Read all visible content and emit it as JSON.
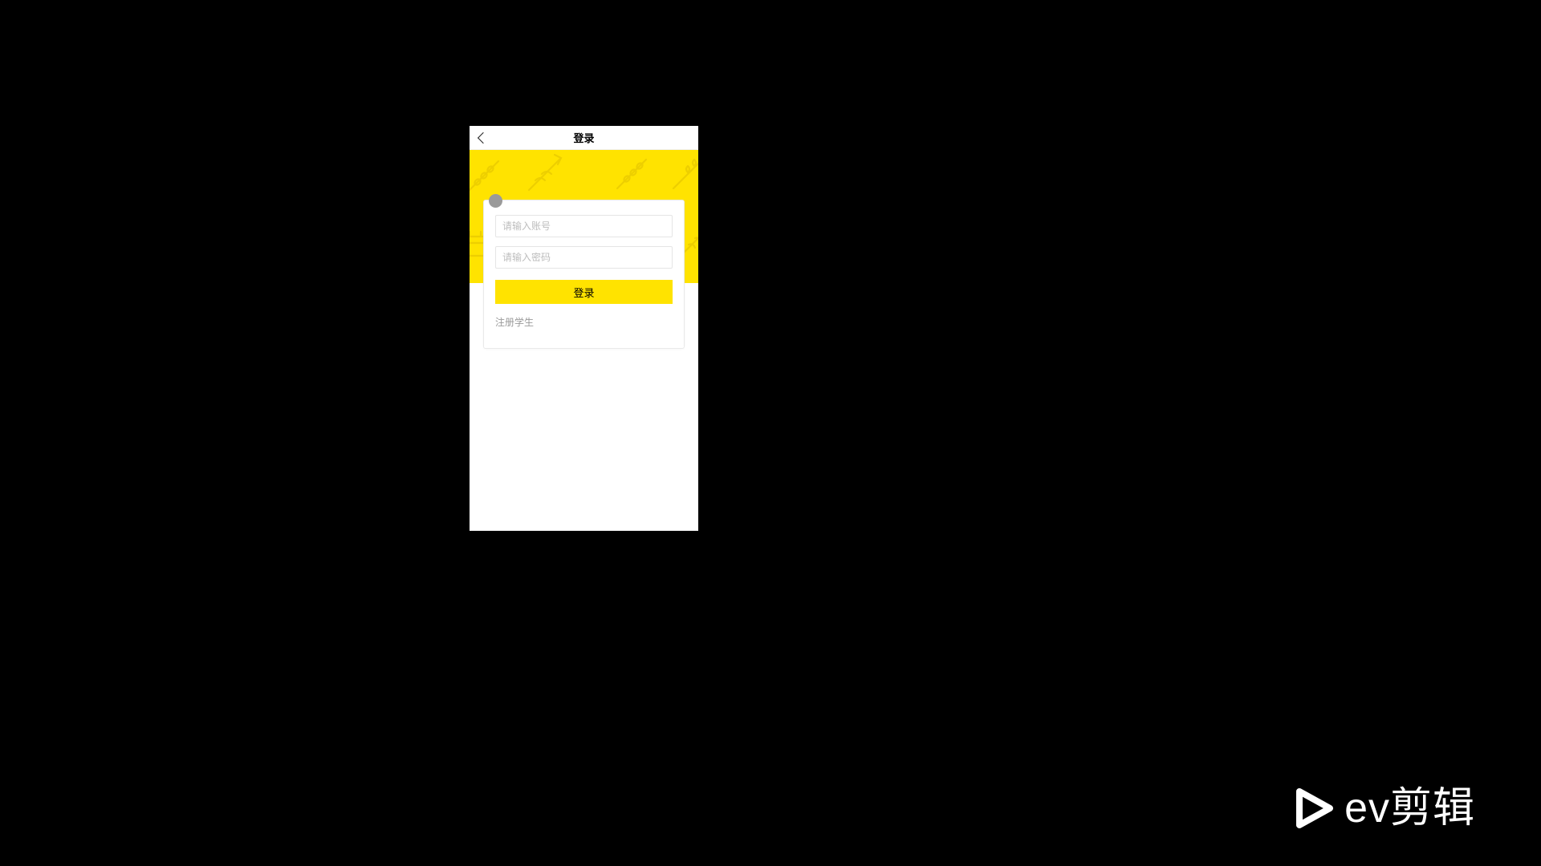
{
  "nav": {
    "title": "登录",
    "back_icon": "chevron-left"
  },
  "login_form": {
    "username_placeholder": "请输入账号",
    "password_placeholder": "请输入密码",
    "submit_label": "登录",
    "register_link": "注册学生"
  },
  "watermark": {
    "brand_latin": "ev",
    "brand_cn": "剪辑"
  },
  "colors": {
    "accent": "#ffe300",
    "bg": "#000000"
  }
}
